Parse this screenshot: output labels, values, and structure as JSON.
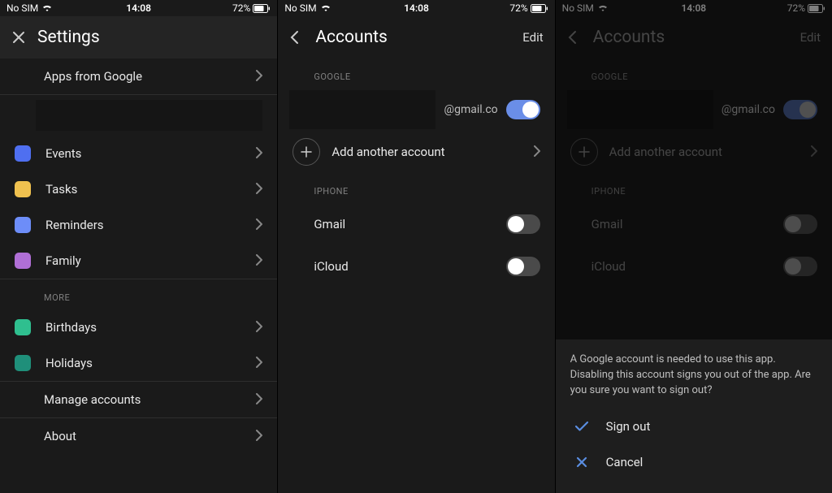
{
  "status": {
    "carrier": "No SIM",
    "time": "14:08",
    "battery": "72%"
  },
  "screen1": {
    "title": "Settings",
    "apps_from_google": "Apps from Google",
    "items": [
      {
        "label": "Events",
        "color": "c-blue1"
      },
      {
        "label": "Tasks",
        "color": "c-yellow"
      },
      {
        "label": "Reminders",
        "color": "c-blue2"
      },
      {
        "label": "Family",
        "color": "c-purple"
      }
    ],
    "more_label": "More",
    "more_items": [
      {
        "label": "Birthdays",
        "color": "c-green"
      },
      {
        "label": "Holidays",
        "color": "c-teal"
      }
    ],
    "manage": "Manage accounts",
    "about": "About"
  },
  "screen2": {
    "title": "Accounts",
    "edit": "Edit",
    "google_label": "Google",
    "email_suffix": "@gmail.co",
    "add_account": "Add another account",
    "iphone_label": "iPhone",
    "iphone_items": [
      {
        "label": "Gmail",
        "on": false
      },
      {
        "label": "iCloud",
        "on": false
      }
    ]
  },
  "screen3": {
    "title": "Accounts",
    "edit": "Edit",
    "google_label": "Google",
    "email_suffix": "@gmail.co",
    "add_account": "Add another account",
    "iphone_label": "iPhone",
    "iphone_items": [
      {
        "label": "Gmail",
        "on": false
      },
      {
        "label": "iCloud",
        "on": false
      }
    ],
    "sheet": {
      "message": "A Google account is needed to use this app. Disabling this account signs you out of the app. Are you sure you want to sign out?",
      "signout": "Sign out",
      "cancel": "Cancel"
    }
  }
}
